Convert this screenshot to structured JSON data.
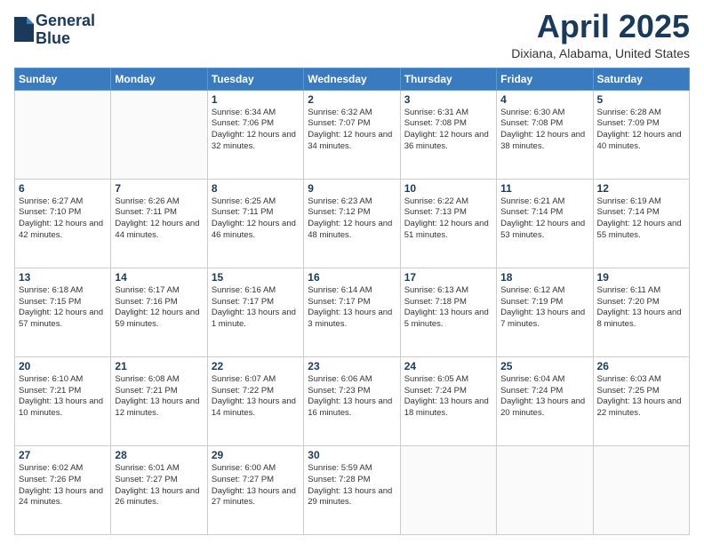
{
  "header": {
    "logo_line1": "General",
    "logo_line2": "Blue",
    "month_title": "April 2025",
    "location": "Dixiana, Alabama, United States"
  },
  "weekdays": [
    "Sunday",
    "Monday",
    "Tuesday",
    "Wednesday",
    "Thursday",
    "Friday",
    "Saturday"
  ],
  "weeks": [
    [
      {
        "day": "",
        "info": ""
      },
      {
        "day": "",
        "info": ""
      },
      {
        "day": "1",
        "info": "Sunrise: 6:34 AM\nSunset: 7:06 PM\nDaylight: 12 hours\nand 32 minutes."
      },
      {
        "day": "2",
        "info": "Sunrise: 6:32 AM\nSunset: 7:07 PM\nDaylight: 12 hours\nand 34 minutes."
      },
      {
        "day": "3",
        "info": "Sunrise: 6:31 AM\nSunset: 7:08 PM\nDaylight: 12 hours\nand 36 minutes."
      },
      {
        "day": "4",
        "info": "Sunrise: 6:30 AM\nSunset: 7:08 PM\nDaylight: 12 hours\nand 38 minutes."
      },
      {
        "day": "5",
        "info": "Sunrise: 6:28 AM\nSunset: 7:09 PM\nDaylight: 12 hours\nand 40 minutes."
      }
    ],
    [
      {
        "day": "6",
        "info": "Sunrise: 6:27 AM\nSunset: 7:10 PM\nDaylight: 12 hours\nand 42 minutes."
      },
      {
        "day": "7",
        "info": "Sunrise: 6:26 AM\nSunset: 7:11 PM\nDaylight: 12 hours\nand 44 minutes."
      },
      {
        "day": "8",
        "info": "Sunrise: 6:25 AM\nSunset: 7:11 PM\nDaylight: 12 hours\nand 46 minutes."
      },
      {
        "day": "9",
        "info": "Sunrise: 6:23 AM\nSunset: 7:12 PM\nDaylight: 12 hours\nand 48 minutes."
      },
      {
        "day": "10",
        "info": "Sunrise: 6:22 AM\nSunset: 7:13 PM\nDaylight: 12 hours\nand 51 minutes."
      },
      {
        "day": "11",
        "info": "Sunrise: 6:21 AM\nSunset: 7:14 PM\nDaylight: 12 hours\nand 53 minutes."
      },
      {
        "day": "12",
        "info": "Sunrise: 6:19 AM\nSunset: 7:14 PM\nDaylight: 12 hours\nand 55 minutes."
      }
    ],
    [
      {
        "day": "13",
        "info": "Sunrise: 6:18 AM\nSunset: 7:15 PM\nDaylight: 12 hours\nand 57 minutes."
      },
      {
        "day": "14",
        "info": "Sunrise: 6:17 AM\nSunset: 7:16 PM\nDaylight: 12 hours\nand 59 minutes."
      },
      {
        "day": "15",
        "info": "Sunrise: 6:16 AM\nSunset: 7:17 PM\nDaylight: 13 hours\nand 1 minute."
      },
      {
        "day": "16",
        "info": "Sunrise: 6:14 AM\nSunset: 7:17 PM\nDaylight: 13 hours\nand 3 minutes."
      },
      {
        "day": "17",
        "info": "Sunrise: 6:13 AM\nSunset: 7:18 PM\nDaylight: 13 hours\nand 5 minutes."
      },
      {
        "day": "18",
        "info": "Sunrise: 6:12 AM\nSunset: 7:19 PM\nDaylight: 13 hours\nand 7 minutes."
      },
      {
        "day": "19",
        "info": "Sunrise: 6:11 AM\nSunset: 7:20 PM\nDaylight: 13 hours\nand 8 minutes."
      }
    ],
    [
      {
        "day": "20",
        "info": "Sunrise: 6:10 AM\nSunset: 7:21 PM\nDaylight: 13 hours\nand 10 minutes."
      },
      {
        "day": "21",
        "info": "Sunrise: 6:08 AM\nSunset: 7:21 PM\nDaylight: 13 hours\nand 12 minutes."
      },
      {
        "day": "22",
        "info": "Sunrise: 6:07 AM\nSunset: 7:22 PM\nDaylight: 13 hours\nand 14 minutes."
      },
      {
        "day": "23",
        "info": "Sunrise: 6:06 AM\nSunset: 7:23 PM\nDaylight: 13 hours\nand 16 minutes."
      },
      {
        "day": "24",
        "info": "Sunrise: 6:05 AM\nSunset: 7:24 PM\nDaylight: 13 hours\nand 18 minutes."
      },
      {
        "day": "25",
        "info": "Sunrise: 6:04 AM\nSunset: 7:24 PM\nDaylight: 13 hours\nand 20 minutes."
      },
      {
        "day": "26",
        "info": "Sunrise: 6:03 AM\nSunset: 7:25 PM\nDaylight: 13 hours\nand 22 minutes."
      }
    ],
    [
      {
        "day": "27",
        "info": "Sunrise: 6:02 AM\nSunset: 7:26 PM\nDaylight: 13 hours\nand 24 minutes."
      },
      {
        "day": "28",
        "info": "Sunrise: 6:01 AM\nSunset: 7:27 PM\nDaylight: 13 hours\nand 26 minutes."
      },
      {
        "day": "29",
        "info": "Sunrise: 6:00 AM\nSunset: 7:27 PM\nDaylight: 13 hours\nand 27 minutes."
      },
      {
        "day": "30",
        "info": "Sunrise: 5:59 AM\nSunset: 7:28 PM\nDaylight: 13 hours\nand 29 minutes."
      },
      {
        "day": "",
        "info": ""
      },
      {
        "day": "",
        "info": ""
      },
      {
        "day": "",
        "info": ""
      }
    ]
  ]
}
